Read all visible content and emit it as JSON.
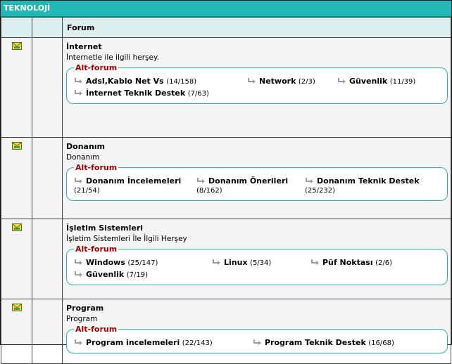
{
  "category": {
    "title": "TEKNOLOJİ"
  },
  "table": {
    "forum_header": "Forum"
  },
  "forums": [
    {
      "name": "İnternet",
      "description": "İnternetle ile ilgili herşey.",
      "legend": "Alt-forum",
      "subforums": [
        {
          "name": "Adsl,Kablo Net Vs",
          "count": "(14/158)"
        },
        {
          "name": "Network",
          "count": "(2/3)"
        },
        {
          "name": "Güvenlik",
          "count": "(11/39)"
        },
        {
          "name": "İnternet Teknik Destek",
          "count": "(7/63)"
        }
      ]
    },
    {
      "name": "Donanım",
      "description": "Donanım",
      "legend": "Alt-forum",
      "subforums": [
        {
          "name": "Donanım İncelemeleri",
          "count": "(21/54)"
        },
        {
          "name": "Donanım Önerileri",
          "count": "(8/162)"
        },
        {
          "name": "Donanım Teknik Destek",
          "count": "(25/232)"
        }
      ]
    },
    {
      "name": "İşletim Sistemleri",
      "description": "İşletim Sistemleri İle İlgili Herşey",
      "legend": "Alt-forum",
      "subforums": [
        {
          "name": "Windows",
          "count": "(25/147)"
        },
        {
          "name": "Linux",
          "count": "(5/34)"
        },
        {
          "name": "Püf Noktası",
          "count": "(2/6)"
        },
        {
          "name": "Güvenlik",
          "count": "(7/19)"
        }
      ]
    },
    {
      "name": "Program",
      "description": "Program",
      "legend": "Alt-forum",
      "subforums": [
        {
          "name": "Program incelemeleri",
          "count": "(22/143)"
        },
        {
          "name": "Program Teknik Destek",
          "count": "(16/68)"
        }
      ]
    }
  ],
  "colors": {
    "header_bg": "#22b8b8",
    "legend": "#a00000",
    "fieldset_border": "#2bb5a8"
  },
  "icons": {
    "forum_status": "envelope-icon",
    "subforum": "subforum-arrow-icon"
  }
}
